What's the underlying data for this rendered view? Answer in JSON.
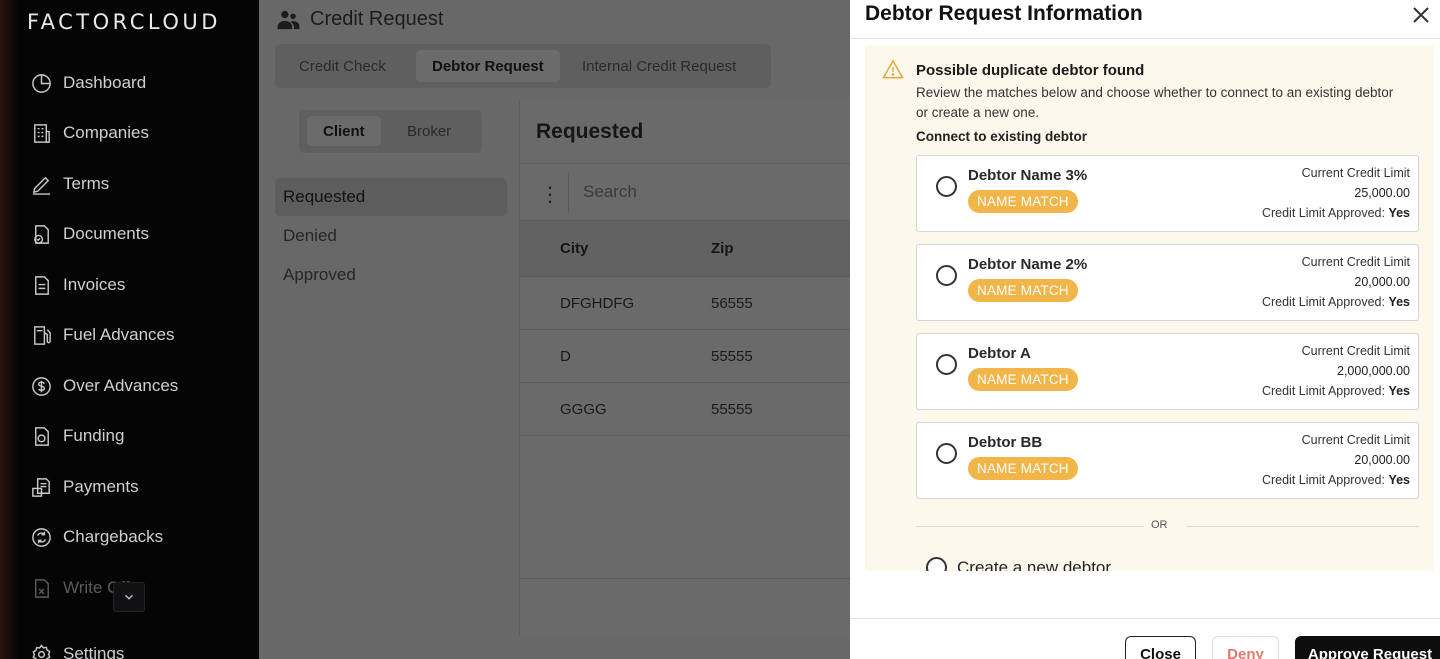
{
  "sidebar": {
    "logo": "FACTORCLOUD",
    "items": [
      {
        "label": "Dashboard",
        "icon": "dashboard-icon"
      },
      {
        "label": "Companies",
        "icon": "building-icon"
      },
      {
        "label": "Terms",
        "icon": "signature-icon"
      },
      {
        "label": "Documents",
        "icon": "document-check-icon"
      },
      {
        "label": "Invoices",
        "icon": "invoice-icon"
      },
      {
        "label": "Fuel Advances",
        "icon": "fuel-icon"
      },
      {
        "label": "Over Advances",
        "icon": "dollar-circle-icon"
      },
      {
        "label": "Funding",
        "icon": "funding-icon"
      },
      {
        "label": "Payments",
        "icon": "payments-icon"
      },
      {
        "label": "Chargebacks",
        "icon": "chargeback-icon"
      },
      {
        "label": "Write Offs",
        "icon": "write-off-icon"
      },
      {
        "label": "Settings",
        "icon": "gear-icon"
      }
    ]
  },
  "main": {
    "title": "Credit Request",
    "tabs": [
      "Credit Check",
      "Debtor Request",
      "Internal Credit Request"
    ],
    "active_tab": "Debtor Request",
    "segments": [
      "Client",
      "Broker"
    ],
    "statuses": [
      "Requested",
      "Denied",
      "Approved"
    ],
    "panel_title": "Requested",
    "search_placeholder": "Search",
    "table": {
      "columns": [
        "City",
        "Zip"
      ],
      "rows": [
        [
          "DFGHDFG",
          "56555"
        ],
        [
          "D",
          "55555"
        ],
        [
          "GGGG",
          "55555"
        ]
      ]
    }
  },
  "modal": {
    "title": "Debtor Request Information",
    "warning_title": "Possible duplicate debtor found",
    "warning_desc": "Review the matches below and choose whether to connect to an existing debtor or create a new one.",
    "connect_label": "Connect to existing debtor",
    "credit_limit_label": "Current Credit Limit",
    "approved_label": "Credit Limit Approved:",
    "badge": "NAME MATCH",
    "debtors": [
      {
        "name": "Debtor Name 3%",
        "limit": "25,000.00",
        "approved": "Yes"
      },
      {
        "name": "Debtor Name 2%",
        "limit": "20,000.00",
        "approved": "Yes"
      },
      {
        "name": "Debtor A",
        "limit": "2,000,000.00",
        "approved": "Yes"
      },
      {
        "name": "Debtor BB",
        "limit": "20,000.00",
        "approved": "Yes"
      }
    ],
    "or_text": "OR",
    "create_new": "Create a new debtor",
    "buttons": {
      "close": "Close",
      "deny": "Deny",
      "approve": "Approve Request"
    }
  },
  "colors": {
    "badge": "#f2b54a",
    "warning_bg": "#fdf8ec",
    "deny_text": "#e07a6d",
    "primary": "#0d0d0d"
  }
}
